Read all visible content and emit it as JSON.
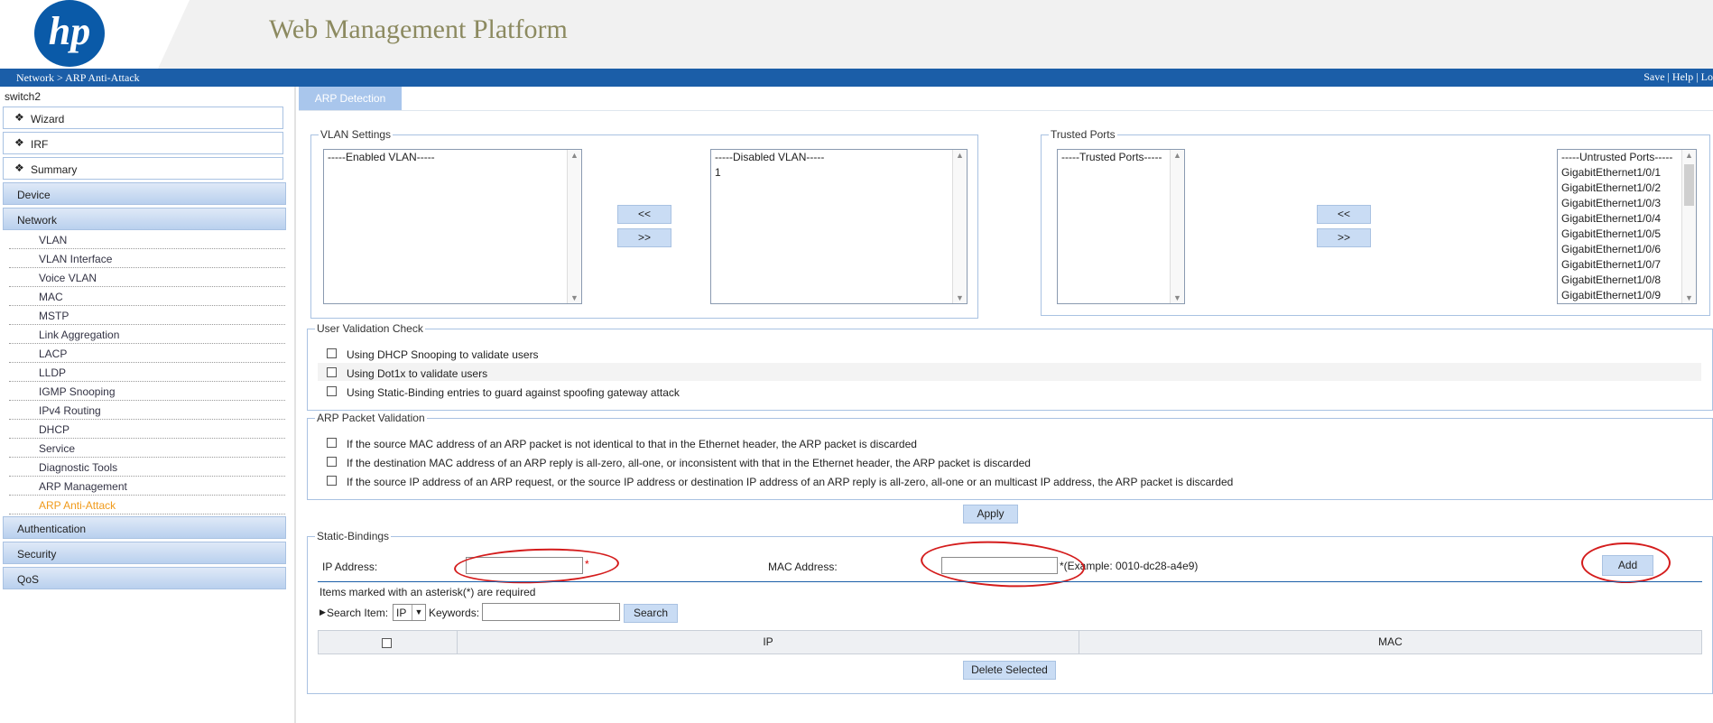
{
  "header": {
    "logo_text": "hp",
    "app_title": "Web Management Platform",
    "breadcrumb": "Network > ARP Anti-Attack",
    "links": [
      "Save",
      "Help",
      "Lo"
    ]
  },
  "sidebar": {
    "device_name": "switch2",
    "top_items": [
      {
        "label": "Wizard"
      },
      {
        "label": "IRF"
      },
      {
        "label": "Summary"
      }
    ],
    "groups": {
      "device": "Device",
      "network": "Network",
      "authentication": "Authentication",
      "security": "Security",
      "qos": "QoS"
    },
    "network_items": [
      {
        "label": "VLAN"
      },
      {
        "label": "VLAN Interface"
      },
      {
        "label": "Voice VLAN"
      },
      {
        "label": "MAC"
      },
      {
        "label": "MSTP"
      },
      {
        "label": "Link Aggregation"
      },
      {
        "label": "LACP"
      },
      {
        "label": "LLDP"
      },
      {
        "label": "IGMP Snooping"
      },
      {
        "label": "IPv4 Routing"
      },
      {
        "label": "DHCP"
      },
      {
        "label": "Service"
      },
      {
        "label": "Diagnostic Tools"
      },
      {
        "label": "ARP Management"
      },
      {
        "label": "ARP Anti-Attack"
      }
    ],
    "active_item": "ARP Anti-Attack",
    "active_color": "#f09a1a"
  },
  "tab": {
    "label": "ARP Detection"
  },
  "vlan_settings": {
    "legend": "VLAN Settings",
    "enabled_header": "-----Enabled VLAN-----",
    "enabled_items": [],
    "disabled_header": "-----Disabled VLAN-----",
    "disabled_items": [
      "1"
    ],
    "move_left": "<<",
    "move_right": ">>"
  },
  "trusted_ports": {
    "legend": "Trusted Ports",
    "trusted_header": "-----Trusted Ports-----",
    "untrusted_header": "-----Untrusted Ports-----",
    "untrusted_items": [
      "GigabitEthernet1/0/1",
      "GigabitEthernet1/0/2",
      "GigabitEthernet1/0/3",
      "GigabitEthernet1/0/4",
      "GigabitEthernet1/0/5",
      "GigabitEthernet1/0/6",
      "GigabitEthernet1/0/7",
      "GigabitEthernet1/0/8",
      "GigabitEthernet1/0/9"
    ],
    "move_left": "<<",
    "move_right": ">>"
  },
  "user_validation": {
    "legend": "User Validation Check",
    "options": [
      {
        "label": "Using DHCP Snooping to validate users",
        "checked": false
      },
      {
        "label": "Using Dot1x to validate users",
        "checked": false
      },
      {
        "label": "Using Static-Binding entries to guard against spoofing gateway attack",
        "checked": false
      }
    ]
  },
  "arp_validation": {
    "legend": "ARP Packet Validation",
    "options": [
      {
        "label": "If the source MAC address of an ARP packet is not identical to that in the Ethernet header, the ARP packet is discarded",
        "checked": false
      },
      {
        "label": "If the destination MAC address of an ARP reply is all-zero, all-one, or inconsistent with that in the Ethernet header, the ARP packet is discarded",
        "checked": false
      },
      {
        "label": "If the source IP address of an ARP request, or the source IP address or destination IP address of an ARP reply is all-zero, all-one or an multicast IP address, the ARP packet is discarded",
        "checked": false
      }
    ]
  },
  "apply_button": "Apply",
  "static_bindings": {
    "legend": "Static-Bindings",
    "ip_label": "IP Address:",
    "ip_value": "",
    "required_mark": "*",
    "mac_label": "MAC Address:",
    "mac_value": "",
    "mac_hint": "*(Example: 0010-dc28-a4e9)",
    "add_button": "Add",
    "required_note": "Items marked with an asterisk(*) are required",
    "search_item_label": "Search Item:",
    "search_item_value": "IP",
    "keywords_label": "Keywords:",
    "keywords_value": "",
    "search_button": "Search",
    "columns": [
      "IP",
      "MAC"
    ],
    "rows": [],
    "delete_button": "Delete Selected"
  }
}
